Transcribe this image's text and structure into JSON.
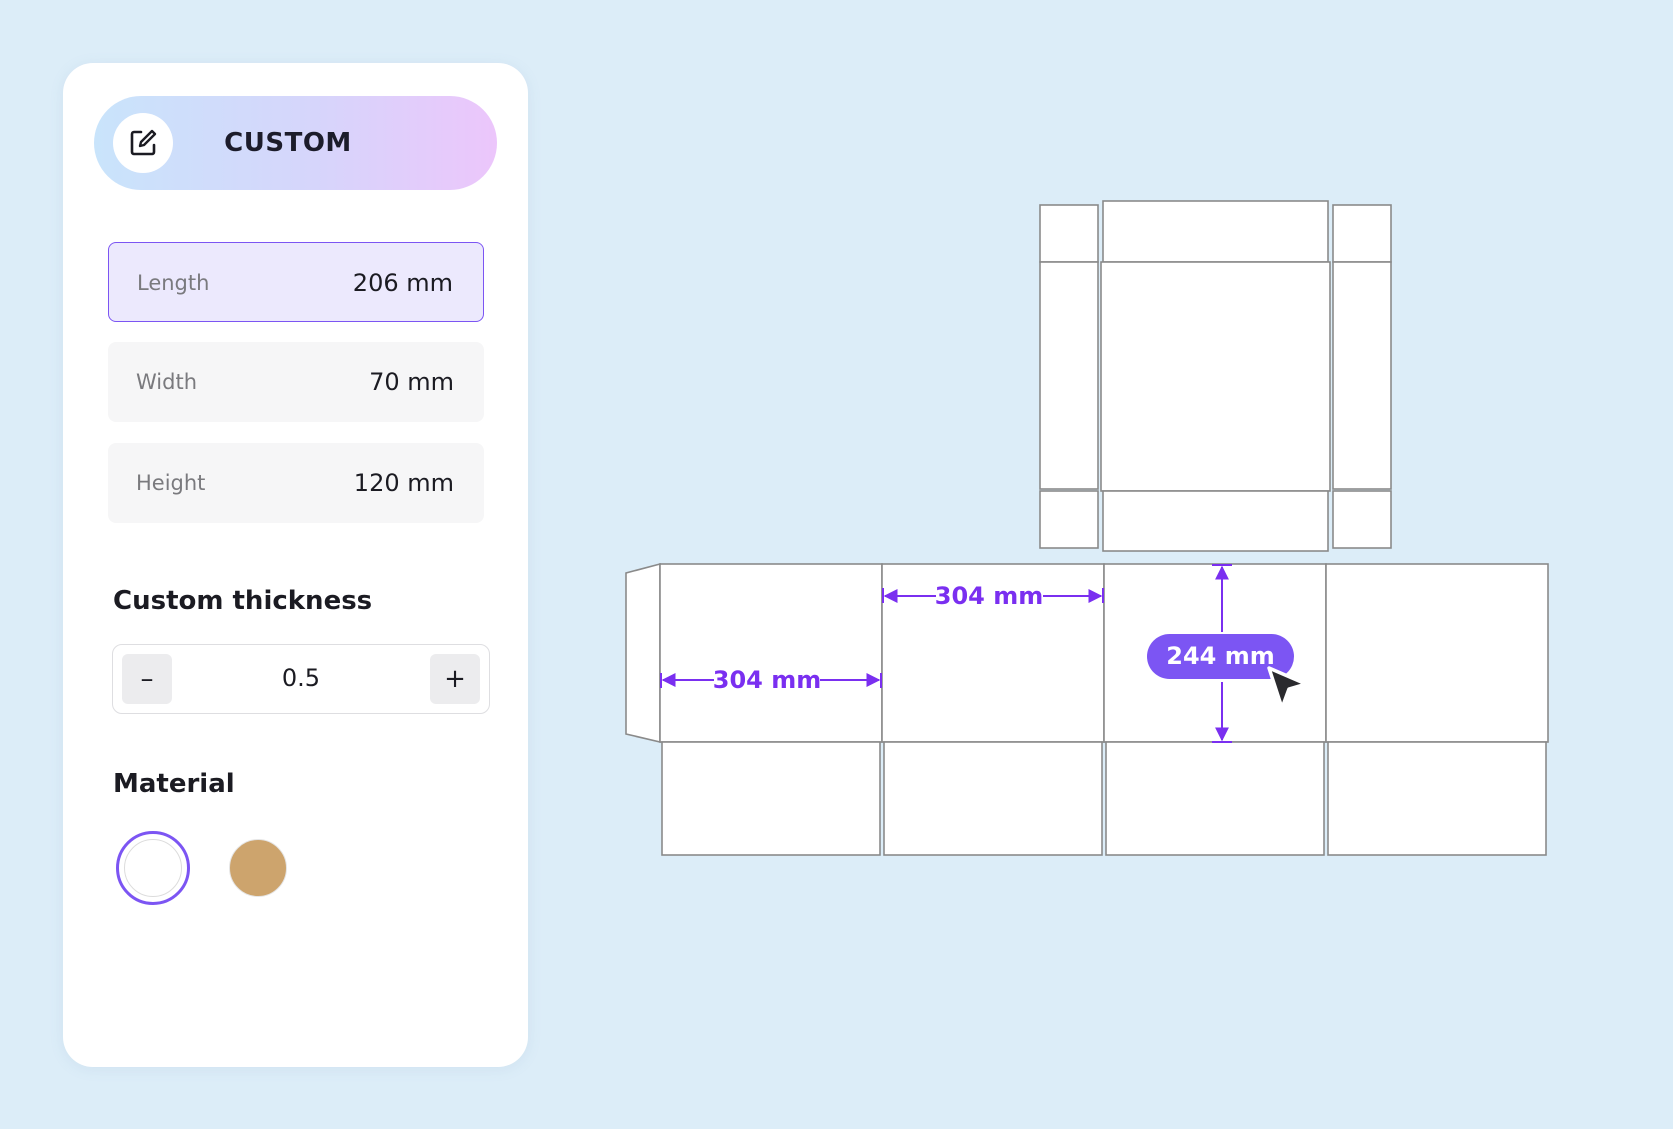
{
  "sidebar": {
    "mode": {
      "label": "CUSTOM",
      "icon": "edit-icon"
    },
    "dimensions": [
      {
        "label": "Length",
        "value": "206 mm",
        "active": true
      },
      {
        "label": "Width",
        "value": "70 mm",
        "active": false
      },
      {
        "label": "Height",
        "value": "120 mm",
        "active": false
      }
    ],
    "thickness": {
      "title": "Custom thickness",
      "value": "0.5",
      "decrement_label": "–",
      "increment_label": "+"
    },
    "material": {
      "title": "Material",
      "options": [
        {
          "name": "white",
          "color": "#ffffff",
          "selected": true
        },
        {
          "name": "kraft",
          "color": "#cda46d",
          "selected": false
        }
      ]
    }
  },
  "canvas": {
    "annotations": {
      "left_panel_width": "304 mm",
      "second_panel_width": "304 mm",
      "height_badge": "244 mm"
    },
    "accent_color": "#7c55f3",
    "cursor": "arrow-cursor-icon"
  }
}
